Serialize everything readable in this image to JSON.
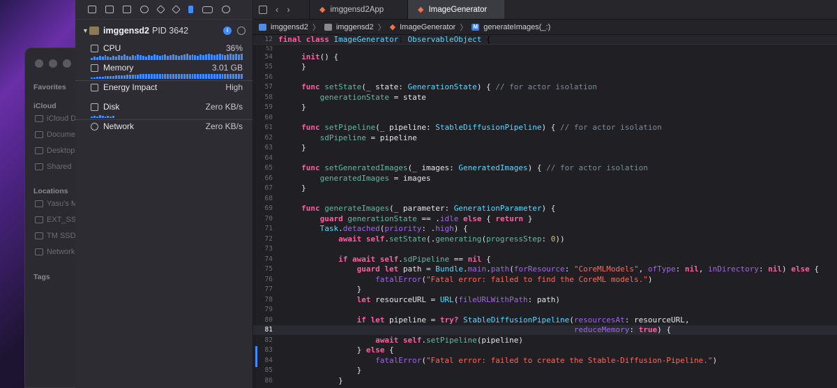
{
  "finder": {
    "sections": [
      {
        "label": "Favorites",
        "items": []
      },
      {
        "label": "iCloud",
        "items": [
          "iCloud D",
          "Docume",
          "Desktop",
          "Shared"
        ]
      },
      {
        "label": "Locations",
        "items": [
          "Yasu's M",
          "EXT_SS",
          "TM SSD",
          "Network"
        ]
      },
      {
        "label": "Tags",
        "items": []
      }
    ]
  },
  "activity": {
    "toolbar_icons": [
      "window-icon",
      "close-square-icon",
      "hierarchy-icon",
      "search-icon",
      "warning-icon",
      "diamond-icon",
      "thermometer-icon",
      "toggle-icon",
      "info-icon"
    ],
    "process": {
      "name": "imggensd2",
      "pid": "PID 3642"
    },
    "metrics": [
      {
        "label": "CPU",
        "value": "36%",
        "icon": "cpu-icon"
      },
      {
        "label": "Memory",
        "value": "3.01 GB",
        "icon": "memory-icon"
      },
      {
        "label": "Energy Impact",
        "value": "High",
        "icon": "bolt-icon"
      },
      {
        "label": "Disk",
        "value": "Zero KB/s",
        "icon": "disk-icon"
      },
      {
        "label": "Network",
        "value": "Zero KB/s",
        "icon": "globe-icon"
      }
    ]
  },
  "xcode": {
    "tabs": [
      {
        "label": "imggensd2App",
        "active": false
      },
      {
        "label": "ImageGenerator",
        "active": true
      }
    ],
    "breadcrumb": [
      "imggensd2",
      "imggensd2",
      "ImageGenerator",
      "generateImages(_:)"
    ],
    "sticky_header": {
      "line": "12",
      "code": "final class ImageGenerator: ObservableObject {"
    },
    "sticky_sub_line": "53",
    "lines": [
      {
        "n": "54",
        "html": "    <span class='k'>init</span>() {"
      },
      {
        "n": "55",
        "html": "    }"
      },
      {
        "n": "56",
        "html": ""
      },
      {
        "n": "57",
        "html": "    <span class='k'>func</span> <span class='f'>setState</span>(_ state: <span class='t'>GenerationState</span>) { <span class='c'>// for actor isolation</span>"
      },
      {
        "n": "58",
        "html": "        <span class='f'>generationState</span> = state"
      },
      {
        "n": "59",
        "html": "    }"
      },
      {
        "n": "60",
        "html": ""
      },
      {
        "n": "61",
        "html": "    <span class='k'>func</span> <span class='f'>setPipeline</span>(_ pipeline: <span class='t'>StableDiffusionPipeline</span>) { <span class='c'>// for actor isolation</span>"
      },
      {
        "n": "62",
        "html": "        <span class='f'>sdPipeline</span> = pipeline"
      },
      {
        "n": "63",
        "html": "    }"
      },
      {
        "n": "64",
        "html": ""
      },
      {
        "n": "65",
        "html": "    <span class='k'>func</span> <span class='f'>setGeneratedImages</span>(_ images: <span class='t'>GeneratedImages</span>) { <span class='c'>// for actor isolation</span>"
      },
      {
        "n": "66",
        "html": "        <span class='f'>generatedImages</span> = images"
      },
      {
        "n": "67",
        "html": "    }"
      },
      {
        "n": "68",
        "html": ""
      },
      {
        "n": "69",
        "html": "    <span class='k'>func</span> <span class='f'>generateImages</span>(_ parameter: <span class='t'>GenerationParameter</span>) {"
      },
      {
        "n": "70",
        "html": "        <span class='k'>guard</span> <span class='f'>generationState</span> == .<span class='p'>idle</span> <span class='k'>else</span> { <span class='k'>return</span> }"
      },
      {
        "n": "71",
        "html": "        <span class='t'>Task</span>.<span class='p'>detached</span>(<span class='p'>priority</span>: .<span class='p'>high</span>) {"
      },
      {
        "n": "72",
        "html": "            <span class='k'>await</span> <span class='k'>self</span>.<span class='f'>setState</span>(.<span class='f'>generating</span>(<span class='f'>progressStep</span>: <span class='n'>0</span>))"
      },
      {
        "n": "73",
        "html": ""
      },
      {
        "n": "74",
        "html": "            <span class='k'>if</span> <span class='k'>await</span> <span class='k'>self</span>.<span class='f'>sdPipeline</span> == <span class='k'>nil</span> {"
      },
      {
        "n": "75",
        "html": "                <span class='k'>guard</span> <span class='k'>let</span> path = <span class='t'>Bundle</span>.<span class='p'>main</span>.<span class='p'>path</span>(<span class='p'>forResource</span>: <span class='s'>\"CoreMLModels\"</span>, <span class='p'>ofType</span>: <span class='k'>nil</span>, <span class='p'>inDirectory</span>: <span class='k'>nil</span>) <span class='k'>else</span> {"
      },
      {
        "n": "76",
        "html": "                    <span class='p'>fatalError</span>(<span class='s'>\"Fatal error: failed to find the CoreML models.\"</span>)"
      },
      {
        "n": "77",
        "html": "                }"
      },
      {
        "n": "78",
        "html": "                <span class='k'>let</span> resourceURL = <span class='t'>URL</span>(<span class='p'>fileURLWithPath</span>: path)"
      },
      {
        "n": "79",
        "html": ""
      },
      {
        "n": "80",
        "html": "                <span class='k'>if</span> <span class='k'>let</span> pipeline = <span class='k'>try?</span> <span class='t'>StableDiffusionPipeline</span>(<span class='p'>resourcesAt</span>: resourceURL,"
      },
      {
        "n": "81",
        "html": "                                                               <span class='p'>reduceMemory</span>: <span class='k'>true</span>) {",
        "current": true
      },
      {
        "n": "82",
        "html": "                    <span class='k'>await</span> <span class='k'>self</span>.<span class='f'>setPipeline</span>(pipeline)"
      },
      {
        "n": "83",
        "html": "                } <span class='k'>else</span> {"
      },
      {
        "n": "84",
        "html": "                    <span class='p'>fatalError</span>(<span class='s'>\"Fatal error: failed to create the Stable-Diffusion-Pipeline.\"</span>)"
      },
      {
        "n": "85",
        "html": "                }"
      },
      {
        "n": "86",
        "html": "            }"
      }
    ]
  }
}
